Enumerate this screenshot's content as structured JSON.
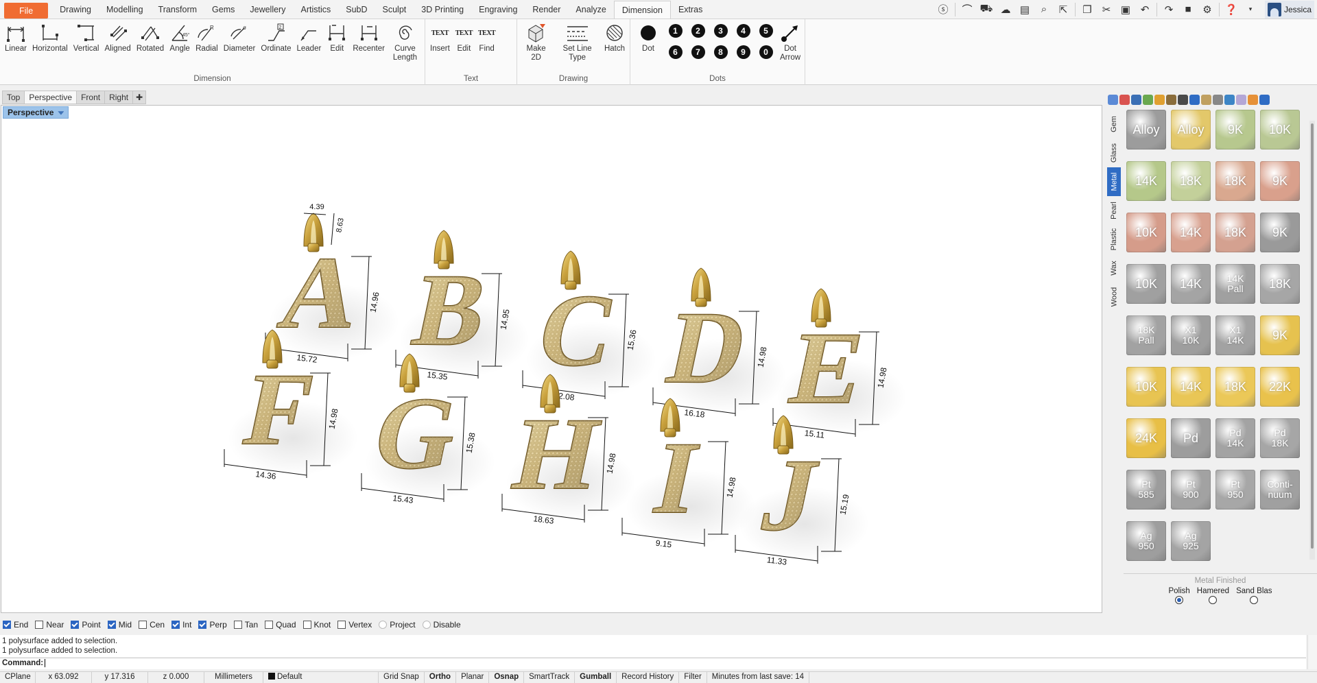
{
  "menu": {
    "file": "File",
    "tabs": [
      "Drawing",
      "Modelling",
      "Transform",
      "Gems",
      "Jewellery",
      "Artistics",
      "SubD",
      "Sculpt",
      "3D Printing",
      "Engraving",
      "Render",
      "Analyze",
      "Dimension",
      "Extras"
    ],
    "active_tab": "Dimension",
    "user": "Jessica"
  },
  "ribbon": {
    "groups": [
      {
        "title": "Dimension",
        "buttons": [
          "Linear",
          "Horizontal",
          "Vertical",
          "Aligned",
          "Rotated",
          "Angle",
          "Radial",
          "Diameter",
          "Ordinate",
          "Leader",
          "Edit",
          "Recenter",
          "Curve Length"
        ]
      },
      {
        "title": "Text",
        "buttons": [
          "Insert",
          "Edit",
          "Find"
        ]
      },
      {
        "title": "Drawing",
        "buttons": [
          "Make 2D",
          "Set Line Type",
          "Hatch"
        ]
      },
      {
        "title": "Dots",
        "dot_label": "Dot",
        "numbers": [
          "1",
          "2",
          "3",
          "4",
          "5",
          "6",
          "7",
          "8",
          "9",
          "0"
        ],
        "arrow_label": "Dot Arrow"
      }
    ],
    "text_icon": "TEXT"
  },
  "viewport_tabs": [
    "Top",
    "Perspective",
    "Front",
    "Right"
  ],
  "viewport_tab_active": "Perspective",
  "viewport_label": "Perspective",
  "scene": {
    "pendants": [
      {
        "letter": "A",
        "width": "15.72",
        "height": "14.96",
        "bail_w": "4.39",
        "bail_h": "8.63"
      },
      {
        "letter": "B",
        "width": "15.35",
        "height": "14.95"
      },
      {
        "letter": "C",
        "width": "12.08",
        "height": "15.36"
      },
      {
        "letter": "D",
        "width": "16.18",
        "height": "14.98"
      },
      {
        "letter": "E",
        "width": "15.11",
        "height": "14.98"
      },
      {
        "letter": "F",
        "width": "14.36",
        "height": "14.98"
      },
      {
        "letter": "G",
        "width": "15.43",
        "height": "15.38"
      },
      {
        "letter": "H",
        "width": "18.63",
        "height": "14.98"
      },
      {
        "letter": "I",
        "width": "9.15",
        "height": "14.98"
      },
      {
        "letter": "J",
        "width": "11.33",
        "height": "15.19"
      }
    ]
  },
  "right_panel": {
    "side_tabs": [
      "Gem",
      "Glass",
      "Metal",
      "Pearl",
      "Plastic",
      "Wax",
      "Wood"
    ],
    "active_side_tab": "Metal",
    "swatches": [
      "#5b8ad6",
      "#d9534f",
      "#3a6fb5",
      "#6aa84f",
      "#e0a030",
      "#8a6d3b",
      "#4a4a4a",
      "#2f6cc4",
      "#c0a060",
      "#888888",
      "#3d85c6",
      "#b4a7d6",
      "#e69138",
      "#2f6cc4"
    ],
    "materials": [
      {
        "label": "Alloy",
        "color": "#9c9c9c"
      },
      {
        "label": "Alloy",
        "color": "#e3c86a"
      },
      {
        "label": "9K",
        "color": "#b7c88e"
      },
      {
        "label": "10K",
        "color": "#b9c894"
      },
      {
        "label": "14K",
        "color": "#b5c88a"
      },
      {
        "label": "18K",
        "color": "#c3d09a"
      },
      {
        "label": "18K",
        "color": "#d9a88f"
      },
      {
        "label": "9K",
        "color": "#d9a08c"
      },
      {
        "label": "10K",
        "color": "#d59c8a"
      },
      {
        "label": "14K",
        "color": "#d8a18f"
      },
      {
        "label": "18K",
        "color": "#d4a190"
      },
      {
        "label": "9K",
        "color": "#9a9a9a"
      },
      {
        "label": "10K",
        "color": "#a0a0a0"
      },
      {
        "label": "14K",
        "color": "#a4a4a4"
      },
      {
        "label": "14K\nPall",
        "color": "#a0a0a0"
      },
      {
        "label": "18K",
        "color": "#a6a6a6"
      },
      {
        "label": "18K\nPall",
        "color": "#a2a2a2"
      },
      {
        "label": "X1\n10K",
        "color": "#9e9e9e"
      },
      {
        "label": "X1\n14K",
        "color": "#a2a2a2"
      },
      {
        "label": "9K",
        "color": "#e6c24f"
      },
      {
        "label": "10K",
        "color": "#e8c452"
      },
      {
        "label": "14K",
        "color": "#e9c656"
      },
      {
        "label": "18K",
        "color": "#ebc858"
      },
      {
        "label": "22K",
        "color": "#e9c24c"
      },
      {
        "label": "24K",
        "color": "#e8bf46"
      },
      {
        "label": "Pd",
        "color": "#9d9d9d"
      },
      {
        "label": "Pd\n14K",
        "color": "#a3a3a3"
      },
      {
        "label": "Pd\n18K",
        "color": "#a6a6a6"
      },
      {
        "label": "Pt\n585",
        "color": "#9c9c9c"
      },
      {
        "label": "Pt\n900",
        "color": "#a2a2a2"
      },
      {
        "label": "Pt\n950",
        "color": "#a7a7a7"
      },
      {
        "label": "Conti-\nnuum",
        "color": "#a0a0a0"
      },
      {
        "label": "Ag\n950",
        "color": "#9e9e9e"
      },
      {
        "label": "Ag\n925",
        "color": "#a4a4a4"
      }
    ],
    "finish_title": "Metal Finished",
    "finish_options": [
      "Polish",
      "Hamered",
      "Sand Blas"
    ],
    "finish_selected": "Polish"
  },
  "osnap": [
    {
      "label": "End",
      "checked": true
    },
    {
      "label": "Near",
      "checked": false
    },
    {
      "label": "Point",
      "checked": true
    },
    {
      "label": "Mid",
      "checked": true
    },
    {
      "label": "Cen",
      "checked": false
    },
    {
      "label": "Int",
      "checked": true
    },
    {
      "label": "Perp",
      "checked": true
    },
    {
      "label": "Tan",
      "checked": false
    },
    {
      "label": "Quad",
      "checked": false
    },
    {
      "label": "Knot",
      "checked": false
    },
    {
      "label": "Vertex",
      "checked": false
    },
    {
      "label": "Project",
      "checked": false,
      "disabled": true
    },
    {
      "label": "Disable",
      "checked": false,
      "disabled": true
    }
  ],
  "command": {
    "history": [
      "1 polysurface added to selection.",
      "1 polysurface added to selection."
    ],
    "prompt": "Command:"
  },
  "status": {
    "cplane": "CPlane",
    "x": "x 63.092",
    "y": "y 17.316",
    "z": "z 0.000",
    "units": "Millimeters",
    "layer": "Default",
    "toggles": [
      {
        "label": "Grid Snap",
        "bold": false
      },
      {
        "label": "Ortho",
        "bold": true
      },
      {
        "label": "Planar",
        "bold": false
      },
      {
        "label": "Osnap",
        "bold": true
      },
      {
        "label": "SmartTrack",
        "bold": false
      },
      {
        "label": "Gumball",
        "bold": true
      },
      {
        "label": "Record History",
        "bold": false
      },
      {
        "label": "Filter",
        "bold": false
      }
    ],
    "save_info": "Minutes from last save: 14"
  }
}
